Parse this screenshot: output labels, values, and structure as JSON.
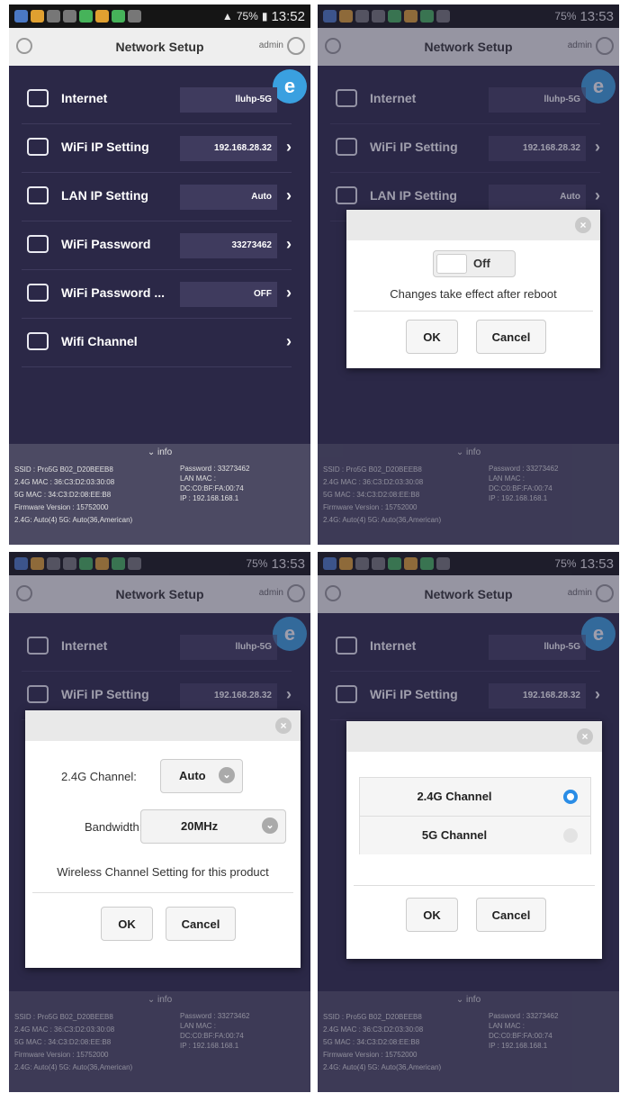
{
  "status_time_1": "13:52",
  "status_time_2": "13:53",
  "status_time_3": "13:53",
  "status_time_4": "13:53",
  "battery": "75%",
  "app": {
    "title": "Network Setup",
    "user": "admin"
  },
  "rows": [
    {
      "label": "Internet",
      "value": "lluhp-5G",
      "icon": "globe-wifi-icon"
    },
    {
      "label": "WiFi IP Setting",
      "value": "192.168.28.32",
      "icon": "router-icon"
    },
    {
      "label": "LAN IP Setting",
      "value": "Auto",
      "icon": "lan-icon"
    },
    {
      "label": "WiFi Password",
      "value": "33273462",
      "icon": "lock-icon"
    },
    {
      "label": "WiFi Password ...",
      "value": "OFF",
      "icon": "wifi-lock-icon"
    },
    {
      "label": "Wifi Channel",
      "value": "",
      "icon": "wifi-icon"
    }
  ],
  "info": {
    "toggle": "info",
    "ssid": "SSID : Pro5G B02_D20BEEB8",
    "mac24": "2.4G MAC : 36:C3:D2:03:30:08",
    "mac5": "5G MAC : 34:C3:D2:08:EE:B8",
    "firmware": "Firmware Version : 15752000",
    "channels": "2.4G: Auto(4)   5G: Auto(36,American)",
    "password": "Password : 33273462",
    "lanmac": "LAN MAC :",
    "lanmac_val": "DC:C0:BF:FA:00:74",
    "ip": "IP : 192.168.168.1"
  },
  "dialog_reboot": {
    "toggle_label": "Off",
    "note": "Changes take effect after reboot",
    "ok": "OK",
    "cancel": "Cancel"
  },
  "dialog_channel": {
    "label_24": "2.4G Channel:",
    "value_24": "Auto",
    "label_bw": "Bandwidth:",
    "value_bw": "20MHz",
    "note": "Wireless Channel Setting for this product",
    "ok": "OK",
    "cancel": "Cancel"
  },
  "dialog_select": {
    "option_1": "2.4G Channel",
    "option_2": "5G Channel",
    "selected": "2.4G Channel",
    "ok": "OK",
    "cancel": "Cancel"
  }
}
